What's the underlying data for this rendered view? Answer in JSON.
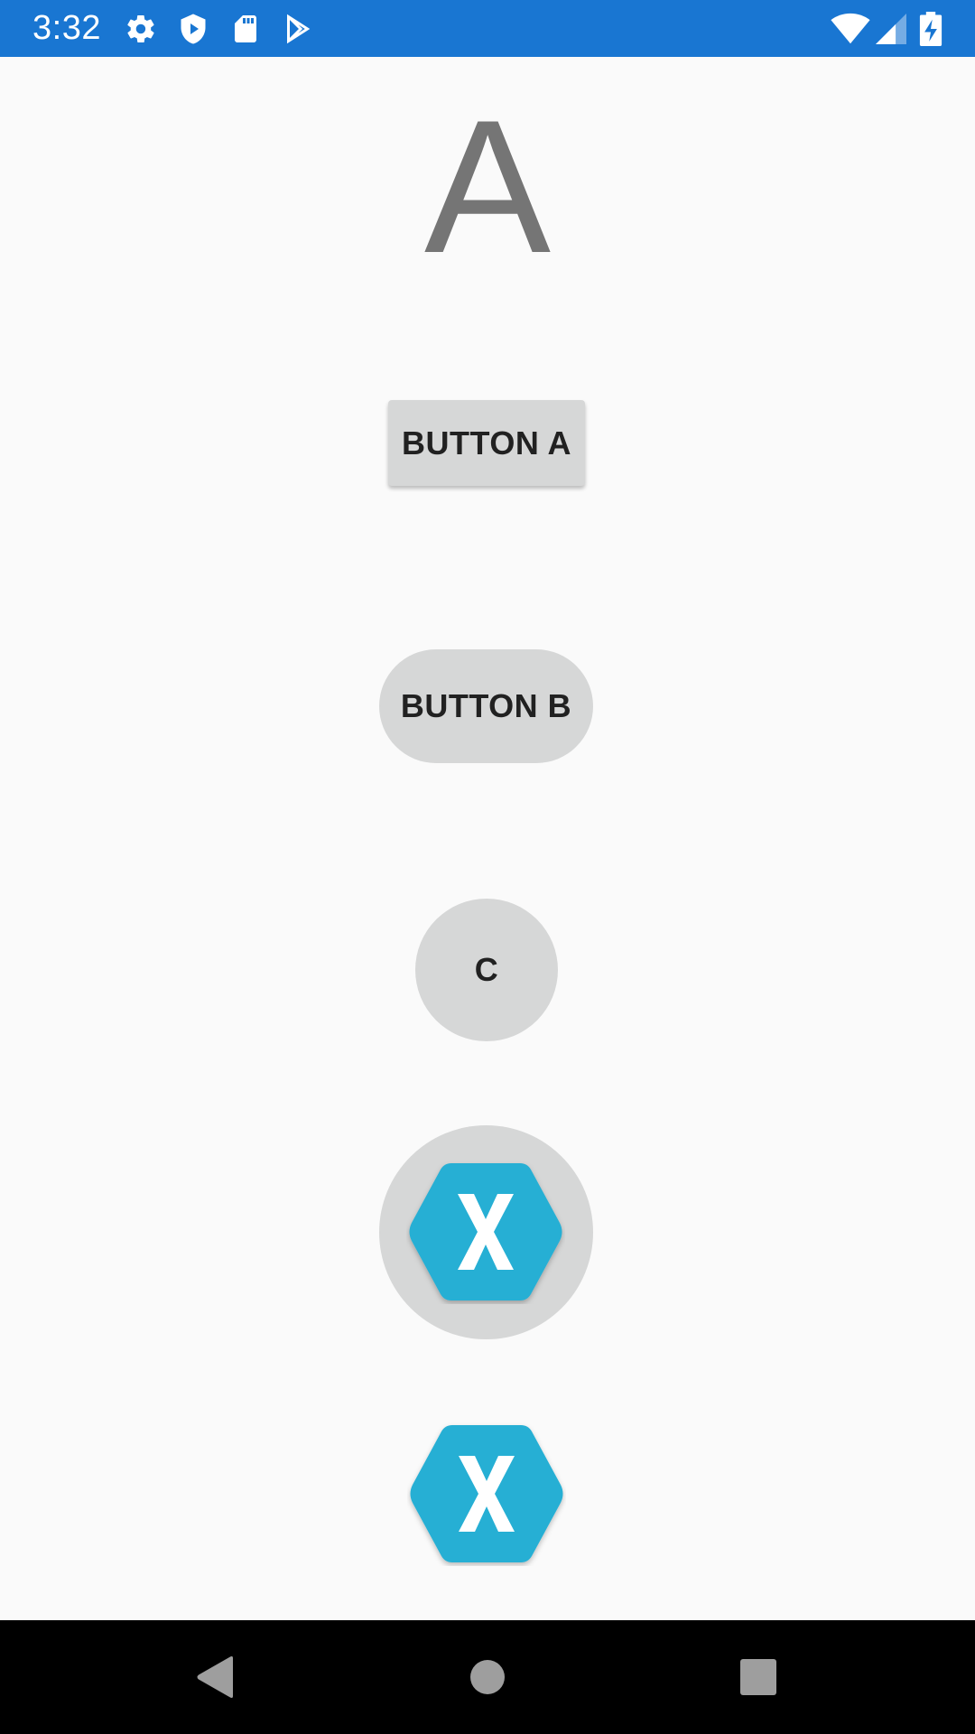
{
  "status_bar": {
    "time": "3:32",
    "color": "#1976d2",
    "left_icons": [
      "gear-icon",
      "shield-play-icon",
      "sd-card-icon",
      "play-store-icon"
    ],
    "right_icons": [
      "wifi-icon",
      "signal-icon",
      "battery-charging-icon"
    ]
  },
  "content": {
    "heading": "A",
    "button_a_label": "BUTTON A",
    "button_b_label": "BUTTON B",
    "button_c_label": "C",
    "image_button_icon": "xamarin-logo-icon",
    "image_icon": "xamarin-logo-icon",
    "accent_color": "#26afd4",
    "button_color": "#d6d7d7"
  },
  "nav_bar": {
    "icons": [
      "back-icon",
      "home-icon",
      "recents-icon"
    ]
  }
}
